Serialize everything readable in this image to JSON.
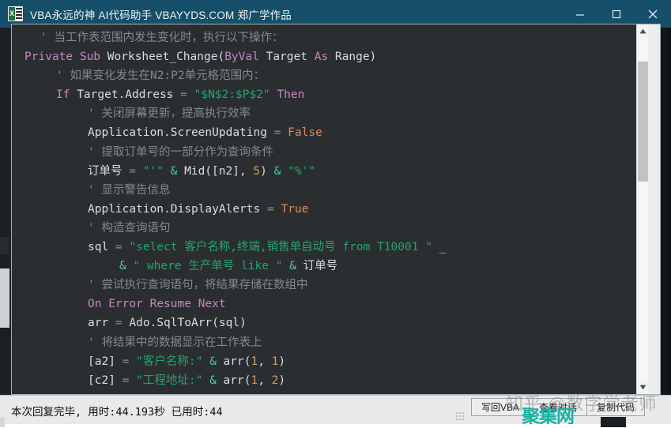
{
  "window": {
    "title": "VBA永远的神 AI代码助手 VBAYYDS.COM 郑广学作品",
    "icon": "excel-icon",
    "controls": {
      "minimize": "minimize-icon",
      "maximize": "maximize-icon",
      "close": "close-icon"
    }
  },
  "editor": {
    "language": "vba",
    "scrollbar": {
      "up_arrow": "▲",
      "down_arrow": "▼"
    },
    "lines": [
      {
        "indent": 1,
        "tokens": [
          {
            "t": "' 当工作表范围内发生变化时，执行以下操作：",
            "c": "cm"
          }
        ]
      },
      {
        "indent": 0,
        "tokens": [
          {
            "t": "Private",
            "c": "kw"
          },
          {
            "t": " ",
            "c": "id"
          },
          {
            "t": "Sub",
            "c": "kw"
          },
          {
            "t": " ",
            "c": "id"
          },
          {
            "t": "Worksheet_Change",
            "c": "fn"
          },
          {
            "t": "(",
            "c": "id"
          },
          {
            "t": "ByVal",
            "c": "kw"
          },
          {
            "t": " Target ",
            "c": "id"
          },
          {
            "t": "As",
            "c": "kw"
          },
          {
            "t": " Range)",
            "c": "id"
          }
        ]
      },
      {
        "indent": 2,
        "tokens": [
          {
            "t": "' 如果变化发生在N2:P2单元格范围内：",
            "c": "cm"
          }
        ]
      },
      {
        "indent": 2,
        "tokens": [
          {
            "t": "If",
            "c": "kw"
          },
          {
            "t": " Target.Address ",
            "c": "id"
          },
          {
            "t": "=",
            "c": "eq"
          },
          {
            "t": " ",
            "c": "id"
          },
          {
            "t": "\"$N$2:$P$2\"",
            "c": "str"
          },
          {
            "t": " ",
            "c": "id"
          },
          {
            "t": "Then",
            "c": "kw"
          }
        ]
      },
      {
        "indent": 4,
        "tokens": [
          {
            "t": "' 关闭屏幕更新，提高执行效率",
            "c": "cm"
          }
        ]
      },
      {
        "indent": 4,
        "tokens": [
          {
            "t": "Application.ScreenUpdating ",
            "c": "id"
          },
          {
            "t": "=",
            "c": "eq"
          },
          {
            "t": " ",
            "c": "id"
          },
          {
            "t": "False",
            "c": "lit"
          }
        ]
      },
      {
        "indent": 4,
        "tokens": [
          {
            "t": "' 提取订单号的一部分作为查询条件",
            "c": "cm"
          }
        ]
      },
      {
        "indent": 4,
        "tokens": [
          {
            "t": "订单号 ",
            "c": "id"
          },
          {
            "t": "=",
            "c": "eq"
          },
          {
            "t": " ",
            "c": "id"
          },
          {
            "t": "\"'\"",
            "c": "str"
          },
          {
            "t": " ",
            "c": "id"
          },
          {
            "t": "&",
            "c": "op"
          },
          {
            "t": " Mid([n2], ",
            "c": "id"
          },
          {
            "t": "5",
            "c": "num"
          },
          {
            "t": ") ",
            "c": "id"
          },
          {
            "t": "&",
            "c": "op"
          },
          {
            "t": " ",
            "c": "id"
          },
          {
            "t": "\"%'\"",
            "c": "str"
          }
        ]
      },
      {
        "indent": 4,
        "tokens": [
          {
            "t": "' 显示警告信息",
            "c": "cm"
          }
        ]
      },
      {
        "indent": 4,
        "tokens": [
          {
            "t": "Application.DisplayAlerts ",
            "c": "id"
          },
          {
            "t": "=",
            "c": "eq"
          },
          {
            "t": " ",
            "c": "id"
          },
          {
            "t": "True",
            "c": "lit"
          }
        ]
      },
      {
        "indent": 4,
        "tokens": [
          {
            "t": "' 构造查询语句",
            "c": "cm"
          }
        ]
      },
      {
        "indent": 4,
        "tokens": [
          {
            "t": "sql ",
            "c": "id"
          },
          {
            "t": "=",
            "c": "eq"
          },
          {
            "t": " ",
            "c": "id"
          },
          {
            "t": "\"select 客户名称,终端,销售单自动号 from T10001 \"",
            "c": "str"
          },
          {
            "t": " _",
            "c": "cont"
          }
        ]
      },
      {
        "indent": 6,
        "tokens": [
          {
            "t": "&",
            "c": "op"
          },
          {
            "t": " ",
            "c": "id"
          },
          {
            "t": "\" where 生产单号 like \"",
            "c": "str"
          },
          {
            "t": " ",
            "c": "id"
          },
          {
            "t": "&",
            "c": "op"
          },
          {
            "t": " 订单号",
            "c": "id"
          }
        ]
      },
      {
        "indent": 4,
        "tokens": [
          {
            "t": "' 尝试执行查询语句，将结果存储在数组中",
            "c": "cm"
          }
        ]
      },
      {
        "indent": 4,
        "tokens": [
          {
            "t": "On",
            "c": "kw"
          },
          {
            "t": " ",
            "c": "id"
          },
          {
            "t": "Error",
            "c": "kw"
          },
          {
            "t": " ",
            "c": "id"
          },
          {
            "t": "Resume",
            "c": "kw"
          },
          {
            "t": " ",
            "c": "id"
          },
          {
            "t": "Next",
            "c": "kw"
          }
        ]
      },
      {
        "indent": 4,
        "tokens": [
          {
            "t": "arr ",
            "c": "id"
          },
          {
            "t": "=",
            "c": "eq"
          },
          {
            "t": " Ado.SqlToArr(sql)",
            "c": "id"
          }
        ]
      },
      {
        "indent": 4,
        "tokens": [
          {
            "t": "' 将结果中的数据显示在工作表上",
            "c": "cm"
          }
        ]
      },
      {
        "indent": 4,
        "tokens": [
          {
            "t": "[a2] ",
            "c": "id"
          },
          {
            "t": "=",
            "c": "eq"
          },
          {
            "t": " ",
            "c": "id"
          },
          {
            "t": "\"客户名称:\"",
            "c": "str"
          },
          {
            "t": " ",
            "c": "id"
          },
          {
            "t": "&",
            "c": "op"
          },
          {
            "t": " arr(",
            "c": "id"
          },
          {
            "t": "1",
            "c": "num"
          },
          {
            "t": ", ",
            "c": "id"
          },
          {
            "t": "1",
            "c": "num"
          },
          {
            "t": ")",
            "c": "id"
          }
        ]
      },
      {
        "indent": 4,
        "tokens": [
          {
            "t": "[c2] ",
            "c": "id"
          },
          {
            "t": "=",
            "c": "eq"
          },
          {
            "t": " ",
            "c": "id"
          },
          {
            "t": "\"工程地址:\"",
            "c": "str"
          },
          {
            "t": " ",
            "c": "id"
          },
          {
            "t": "&",
            "c": "op"
          },
          {
            "t": " arr(",
            "c": "id"
          },
          {
            "t": "1",
            "c": "num"
          },
          {
            "t": ", ",
            "c": "id"
          },
          {
            "t": "2",
            "c": "num"
          },
          {
            "t": ")",
            "c": "id"
          }
        ]
      }
    ]
  },
  "statusbar": {
    "message": "本次回复完毕, 用时:44.193秒 已用时:44",
    "buttons": [
      {
        "label": "写回VBA",
        "name": "write-back-vba-button"
      },
      {
        "label": "查看对话",
        "name": "view-conversation-button"
      },
      {
        "label": "复制代码",
        "name": "copy-code-button"
      }
    ],
    "resize_grip": "resize-grip"
  },
  "watermarks": {
    "zhihu": "知乎 @数字学老师",
    "jujie": "聚集网"
  },
  "colors": {
    "titlebar": "#154f69",
    "editor_bg": "#2b2e31",
    "comment": "#7f8b8b",
    "keyword": "#c586c0",
    "string": "#24a46d",
    "number": "#d09a5c",
    "operator": "#4ec9b0",
    "literal": "#d98a63",
    "watermark_green": "#19b3a6"
  }
}
